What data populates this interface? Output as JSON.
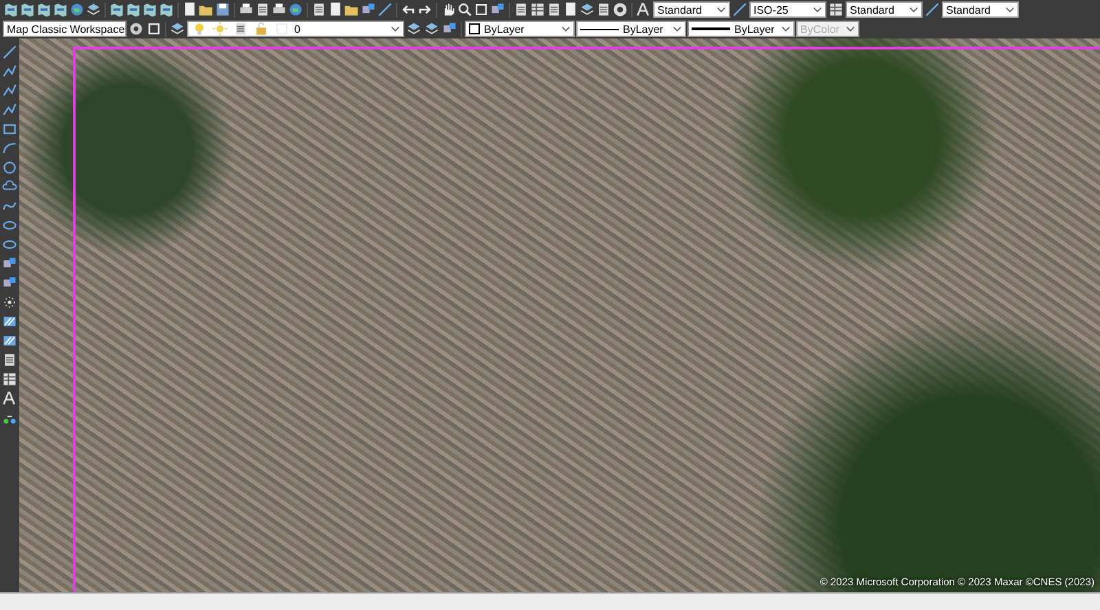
{
  "toolbar_row_1": {
    "combos": [
      {
        "label": "Standard",
        "disabled": false
      },
      {
        "label": "ISO-25",
        "disabled": false
      },
      {
        "label": "Standard",
        "disabled": false
      },
      {
        "label": "Standard",
        "disabled": false
      }
    ]
  },
  "toolbar_row_2": {
    "workspace": {
      "label": "Map Classic Workspace",
      "disabled": false
    },
    "layer": {
      "label": "0",
      "disabled": false
    },
    "properties": [
      {
        "kind": "color",
        "label": "ByLayer",
        "disabled": false
      },
      {
        "kind": "linetype",
        "label": "ByLayer",
        "disabled": false
      },
      {
        "kind": "lineweight",
        "label": "ByLayer",
        "disabled": false
      },
      {
        "kind": "plain",
        "label": "ByColor",
        "disabled": true
      }
    ]
  },
  "map": {
    "attribution": "© 2023 Microsoft Corporation © 2023 Maxar ©CNES (2023)"
  }
}
